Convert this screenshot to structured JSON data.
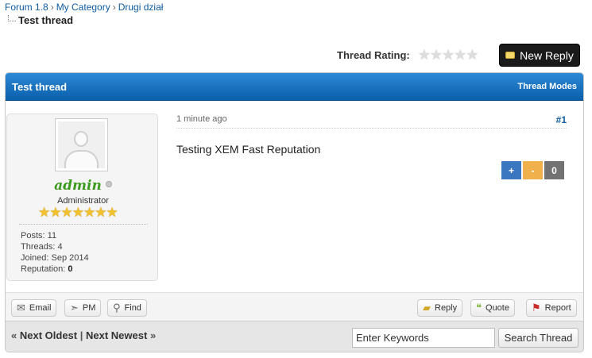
{
  "breadcrumb": {
    "items": [
      "Forum 1.8",
      "My Category",
      "Drugi dział"
    ],
    "separator": "›",
    "current": "Test thread"
  },
  "rating": {
    "label": "Thread Rating:",
    "value": 0,
    "max": 5,
    "star_char": "★"
  },
  "new_reply": {
    "label": "New Reply",
    "icon": "speech-bubble-icon"
  },
  "thread": {
    "title": "Test thread",
    "modes": "Thread Modes"
  },
  "post": {
    "time": "1 minute ago",
    "number": "#1",
    "content": "Testing XEM Fast Reputation",
    "reputation_buttons": {
      "plus": "+",
      "minus": "-",
      "zero": "0"
    },
    "author": {
      "username": "admin",
      "usertitle": "Administrator",
      "stars": 7,
      "star_char": "★",
      "status": "offline",
      "stats": {
        "posts_label": "Posts:",
        "posts": "11",
        "threads_label": "Threads:",
        "threads": "4",
        "joined_label": "Joined:",
        "joined": "Sep 2014",
        "reputation_label": "Reputation:",
        "reputation": "0"
      }
    }
  },
  "controls": {
    "email": {
      "label": "Email",
      "icon": "envelope-icon"
    },
    "pm": {
      "label": "PM",
      "icon": "paper-plane-icon"
    },
    "find": {
      "label": "Find",
      "icon": "magnifier-icon"
    },
    "reply": {
      "label": "Reply",
      "icon": "speech-bubble-icon"
    },
    "quote": {
      "label": "Quote",
      "icon": "quote-bubble-icon"
    },
    "report": {
      "label": "Report",
      "icon": "flag-icon"
    }
  },
  "footer": {
    "prev_arrow": "«",
    "next_oldest": "Next Oldest",
    "divider": "|",
    "next_newest": "Next Newest",
    "next_arrow": "»",
    "search_placeholder": "Enter Keywords",
    "search_button": "Search Thread"
  },
  "colors": {
    "header_blue": "#0a5faa",
    "username_green": "#3c9a1e",
    "rep_plus": "#3b77c0",
    "rep_minus": "#f0b04c",
    "rep_zero": "#727272"
  }
}
